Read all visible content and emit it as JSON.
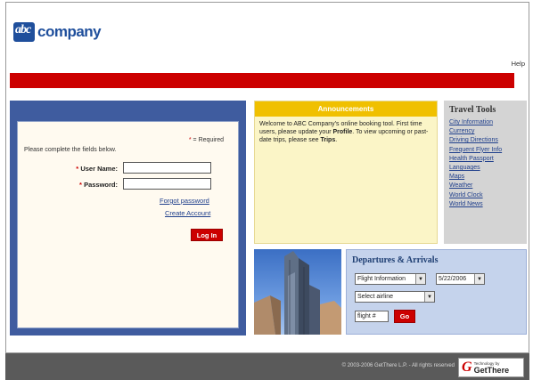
{
  "header": {
    "logo_mark": "abc",
    "logo_text": "company",
    "help_link": "Help",
    "brand_color": "#1f4f9c",
    "bar_color": "#cc0000"
  },
  "login": {
    "required_star": "*",
    "required_label": " = Required",
    "instructions": "Please complete the fields below.",
    "username_label": "User Name:",
    "password_label": "Password:",
    "username_value": "",
    "password_value": "",
    "forgot_password": "Forgot password",
    "create_account": "Create Account",
    "login_button": "Log In"
  },
  "announcements": {
    "title": "Announcements",
    "text_1": "Welcome to ABC Company's online booking tool. First time users, please update your ",
    "profile": "Profile",
    "text_2": ". To view upcoming or past-date trips, please see ",
    "trips": "Trips",
    "text_3": "."
  },
  "travel_tools": {
    "title": "Travel Tools",
    "links": [
      "City Information",
      "Currency",
      "Driving Directions",
      "Frequent Flyer Info",
      "Health Passport",
      "Languages",
      "Maps",
      "Weather",
      "World Clock",
      "World News"
    ]
  },
  "departures": {
    "title": "Departures & Arrivals",
    "type_select": "Flight Information",
    "date_select": "5/22/2006",
    "airline_select": "Select airline",
    "flight_placeholder": "flight #",
    "go_button": "Go"
  },
  "footer": {
    "copyright": "© 2003-2006 GetThere L.P. - All rights reserved",
    "badge_small": "Technology by",
    "badge_big": "GetThere",
    "badge_mark": "G"
  }
}
